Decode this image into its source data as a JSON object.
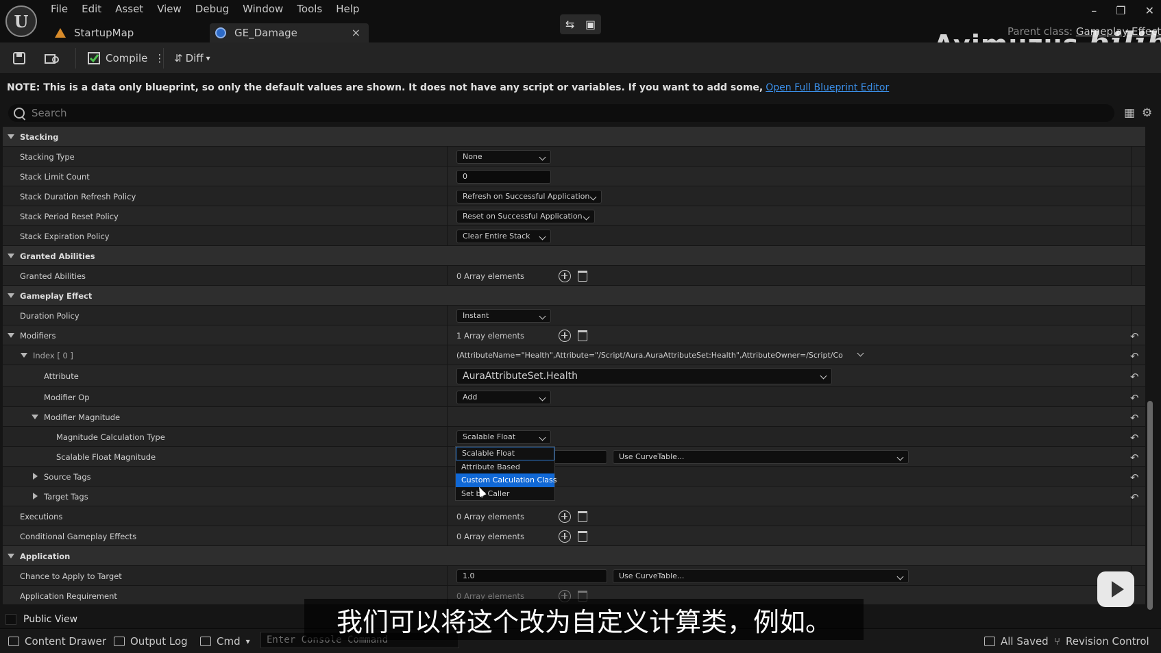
{
  "app": {
    "logo_text": "U",
    "menu": [
      "File",
      "Edit",
      "Asset",
      "View",
      "Debug",
      "Window",
      "Tools",
      "Help"
    ],
    "tabs": [
      {
        "label": "StartupMap"
      },
      {
        "label": "GE_Damage",
        "close": "×"
      }
    ],
    "parent_class_label": "Parent class:",
    "parent_class_value": "Gameplay Effect",
    "watermark": "Ayimuzus",
    "watermark_brand": "bilibili",
    "window_controls": [
      "–",
      "❐",
      "✕"
    ]
  },
  "toolbar": {
    "compile_label": "Compile",
    "diff_label": "Diff"
  },
  "note": {
    "text": "NOTE: This is a data only blueprint, so only the default values are shown.  It does not have any script or variables.  If you want to add some,",
    "link": "Open Full Blueprint Editor"
  },
  "search": {
    "placeholder": "Search"
  },
  "details": {
    "stacking": {
      "header": "Stacking",
      "stacking_type": {
        "label": "Stacking Type",
        "value": "None"
      },
      "stack_limit_count": {
        "label": "Stack Limit Count",
        "value": "0"
      },
      "duration_refresh": {
        "label": "Stack Duration Refresh Policy",
        "value": "Refresh on Successful Application"
      },
      "period_reset": {
        "label": "Stack Period Reset Policy",
        "value": "Reset on Successful Application"
      },
      "expiration": {
        "label": "Stack Expiration Policy",
        "value": "Clear Entire Stack"
      }
    },
    "granted": {
      "header": "Granted Abilities",
      "abilities": {
        "label": "Granted Abilities",
        "value": "0 Array elements"
      }
    },
    "gameplay_effect": {
      "header": "Gameplay Effect",
      "duration_policy": {
        "label": "Duration Policy",
        "value": "Instant"
      },
      "modifiers": {
        "label": "Modifiers",
        "value": "1 Array elements"
      },
      "index0": {
        "label": "Index [ 0 ]",
        "value": "(AttributeName=\"Health\",Attribute=\"/Script/Aura.AuraAttributeSet:Health\",AttributeOwner=/Script/Co"
      },
      "attribute": {
        "label": "Attribute",
        "value": "AuraAttributeSet.Health"
      },
      "modifier_op": {
        "label": "Modifier Op",
        "value": "Add"
      },
      "modifier_magnitude": {
        "label": "Modifier Magnitude"
      },
      "calc_type": {
        "label": "Magnitude Calculation Type",
        "value": "Scalable Float"
      },
      "scalable_float": {
        "label": "Scalable Float Magnitude",
        "curve": "Use CurveTable..."
      },
      "source_tags": {
        "label": "Source Tags"
      },
      "target_tags": {
        "label": "Target Tags"
      },
      "executions": {
        "label": "Executions",
        "value": "0 Array elements"
      },
      "conditional": {
        "label": "Conditional Gameplay Effects",
        "value": "0 Array elements"
      }
    },
    "application": {
      "header": "Application",
      "chance": {
        "label": "Chance to Apply to Target",
        "value": "1.0",
        "curve": "Use CurveTable..."
      },
      "requirement": {
        "label": "Application Requirement",
        "value": "0 Array elements"
      }
    },
    "dropdown_options": [
      "Scalable Float",
      "Attribute Based",
      "Custom Calculation Class",
      "Set by Caller"
    ]
  },
  "public_view": "Public View",
  "subtitle": "我们可以将这个改为自定义计算类，例如。",
  "statusbar": {
    "content_drawer": "Content Drawer",
    "output_log": "Output Log",
    "cmd": "Cmd",
    "console_placeholder": "Enter Console Command",
    "all_saved": "All Saved",
    "revision_control": "Revision Control"
  },
  "colors": {
    "accent_blue": "#1068d6",
    "link_blue": "#3b8fe8",
    "panel_bg": "#1c1c1c"
  }
}
